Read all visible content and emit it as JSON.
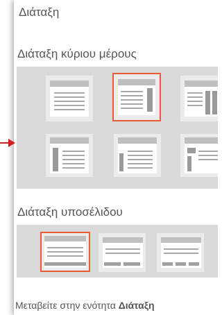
{
  "panel": {
    "title": "Διάταξη",
    "main_layout": {
      "heading": "Διάταξη κύριου μέρους",
      "options": [
        {
          "name": "layout-full",
          "selected": false
        },
        {
          "name": "layout-right-sidebar",
          "selected": true
        },
        {
          "name": "layout-two-right-sidebars",
          "selected": false
        },
        {
          "name": "layout-left-sidebar",
          "selected": false
        },
        {
          "name": "layout-left-narrow-sidebar",
          "selected": false
        },
        {
          "name": "layout-split-columns",
          "selected": false
        }
      ]
    },
    "footer_layout": {
      "heading": "Διάταξη υποσέλιδου",
      "options": [
        {
          "name": "footer-one-column",
          "selected": true
        },
        {
          "name": "footer-two-columns",
          "selected": false
        },
        {
          "name": "footer-three-columns",
          "selected": false
        }
      ]
    },
    "footer_hint": {
      "prefix": "Μεταβείτε στην ενότητα ",
      "bold": "Διάταξη"
    }
  },
  "colors": {
    "accent": "#ec5a33",
    "panel_bg": "#d9d9d9",
    "arrow": "#cc1f1f"
  }
}
